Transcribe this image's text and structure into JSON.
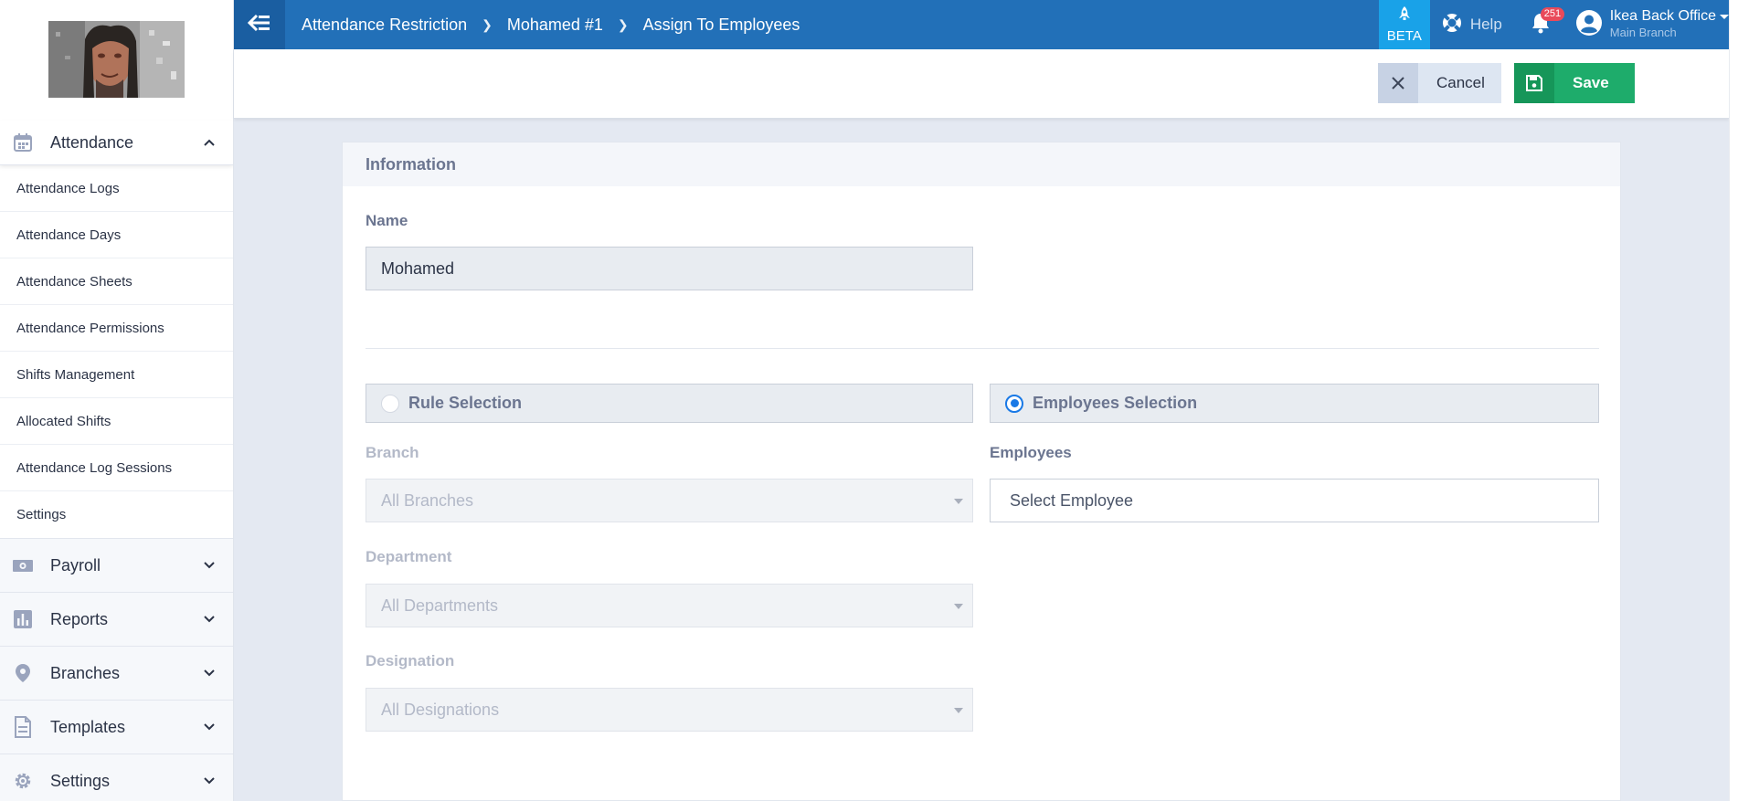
{
  "sidebar": {
    "sections": [
      {
        "label": "Attendance",
        "icon": "calendar-icon",
        "expanded": true
      },
      {
        "label": "Payroll",
        "icon": "money-icon"
      },
      {
        "label": "Reports",
        "icon": "bar-chart-icon"
      },
      {
        "label": "Branches",
        "icon": "map-pin-icon"
      },
      {
        "label": "Templates",
        "icon": "document-icon"
      },
      {
        "label": "Settings",
        "icon": "gear-icon"
      }
    ],
    "attendance_items": [
      "Attendance Logs",
      "Attendance Days",
      "Attendance Sheets",
      "Attendance Permissions",
      "Shifts Management",
      "Allocated Shifts",
      "Attendance Log Sessions",
      "Settings"
    ]
  },
  "topbar": {
    "breadcrumbs": [
      "Attendance Restriction",
      "Mohamed #1",
      "Assign To Employees"
    ],
    "beta_label": "BETA",
    "help_label": "Help",
    "notification_count": "251",
    "account_name": "Ikea Back Office",
    "account_branch": "Main Branch"
  },
  "actions": {
    "cancel_label": "Cancel",
    "save_label": "Save"
  },
  "form": {
    "section_title": "Information",
    "name_label": "Name",
    "name_value": "Mohamed",
    "rule_selection_label": "Rule Selection",
    "employees_selection_label": "Employees Selection",
    "selected_mode": "Employees Selection",
    "branch_label": "Branch",
    "branch_value": "All Branches",
    "department_label": "Department",
    "department_value": "All Departments",
    "designation_label": "Designation",
    "designation_value": "All Designations",
    "employees_label": "Employees",
    "employees_placeholder": "Select Employee"
  },
  "colors": {
    "topbar": "#2270b8",
    "beta": "#19a2e8",
    "save": "#1eac6b",
    "radio_active": "#1979e6",
    "badge": "#e94a5a"
  }
}
